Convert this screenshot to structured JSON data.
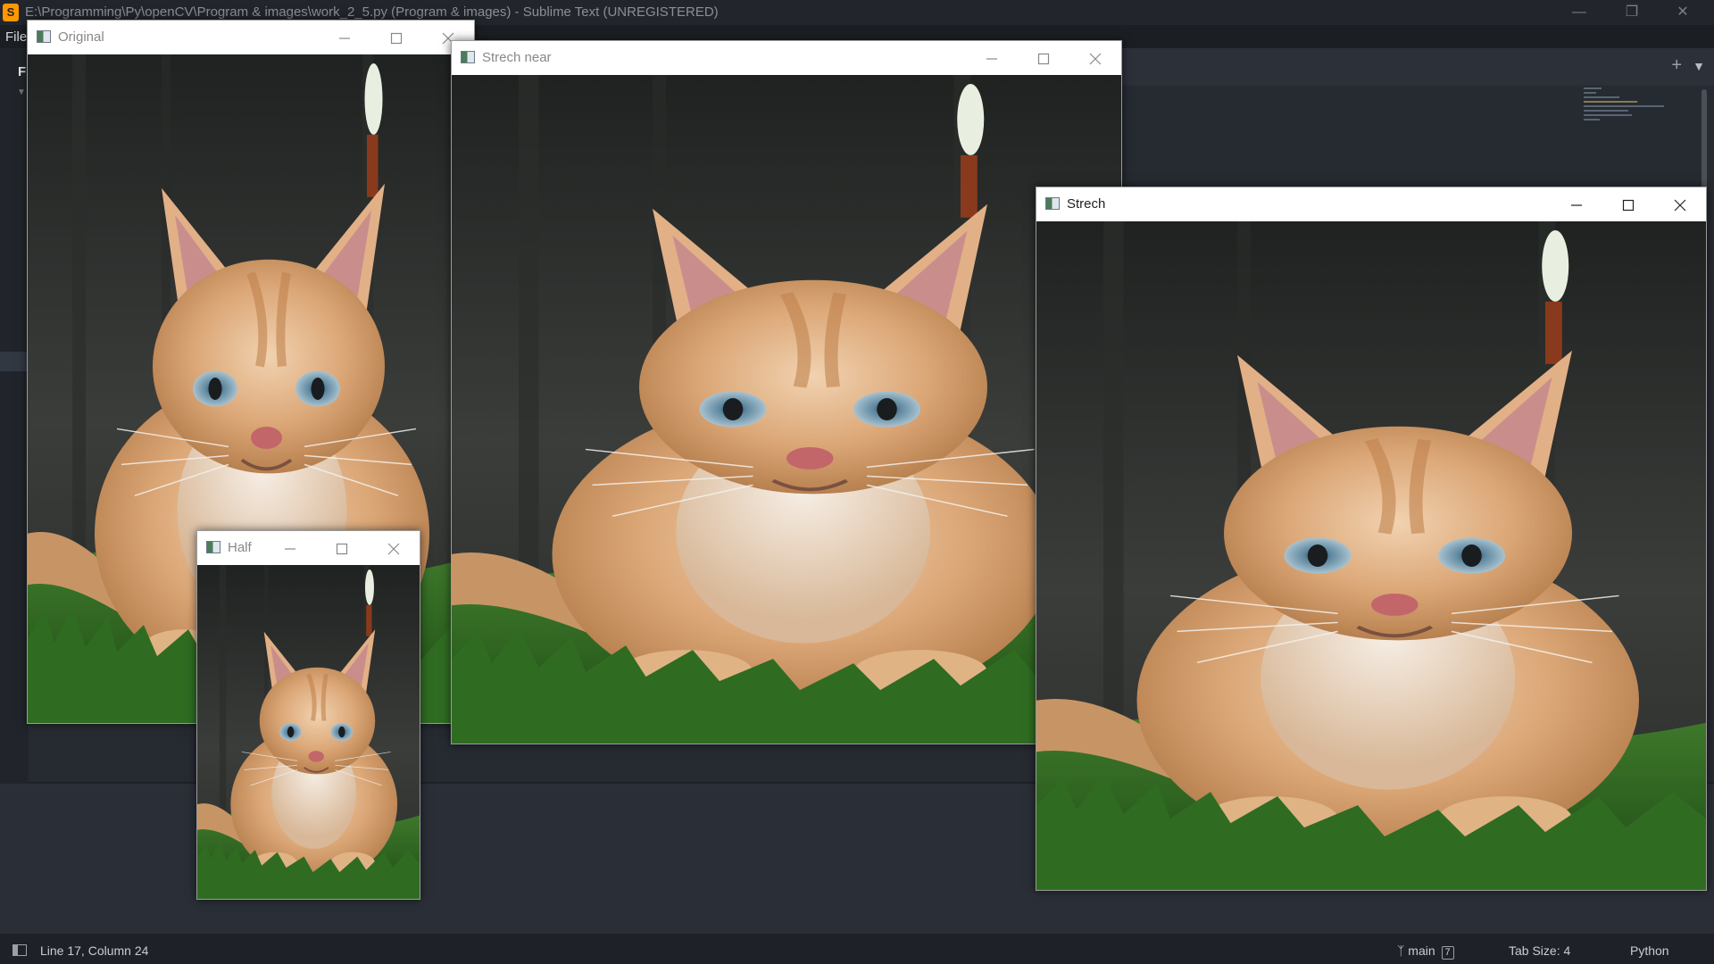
{
  "sublime": {
    "title": "E:\\Programming\\Py\\openCV\\Program & images\\work_2_5.py (Program & images) - Sublime Text (UNREGISTERED)",
    "app_icon_glyph": "S",
    "menu_file": "File",
    "sidebar_label": "F",
    "status": {
      "position": "Line 17, Column 24",
      "branch": "main",
      "branch_count": "7",
      "tab_size": "Tab Size: 4",
      "syntax": "Python"
    },
    "accent_color": "#ff9800"
  },
  "windows": {
    "original": {
      "title": "Original"
    },
    "strech_near": {
      "title": "Strech near"
    },
    "strech": {
      "title": "Strech"
    },
    "half": {
      "title": "Half"
    }
  }
}
